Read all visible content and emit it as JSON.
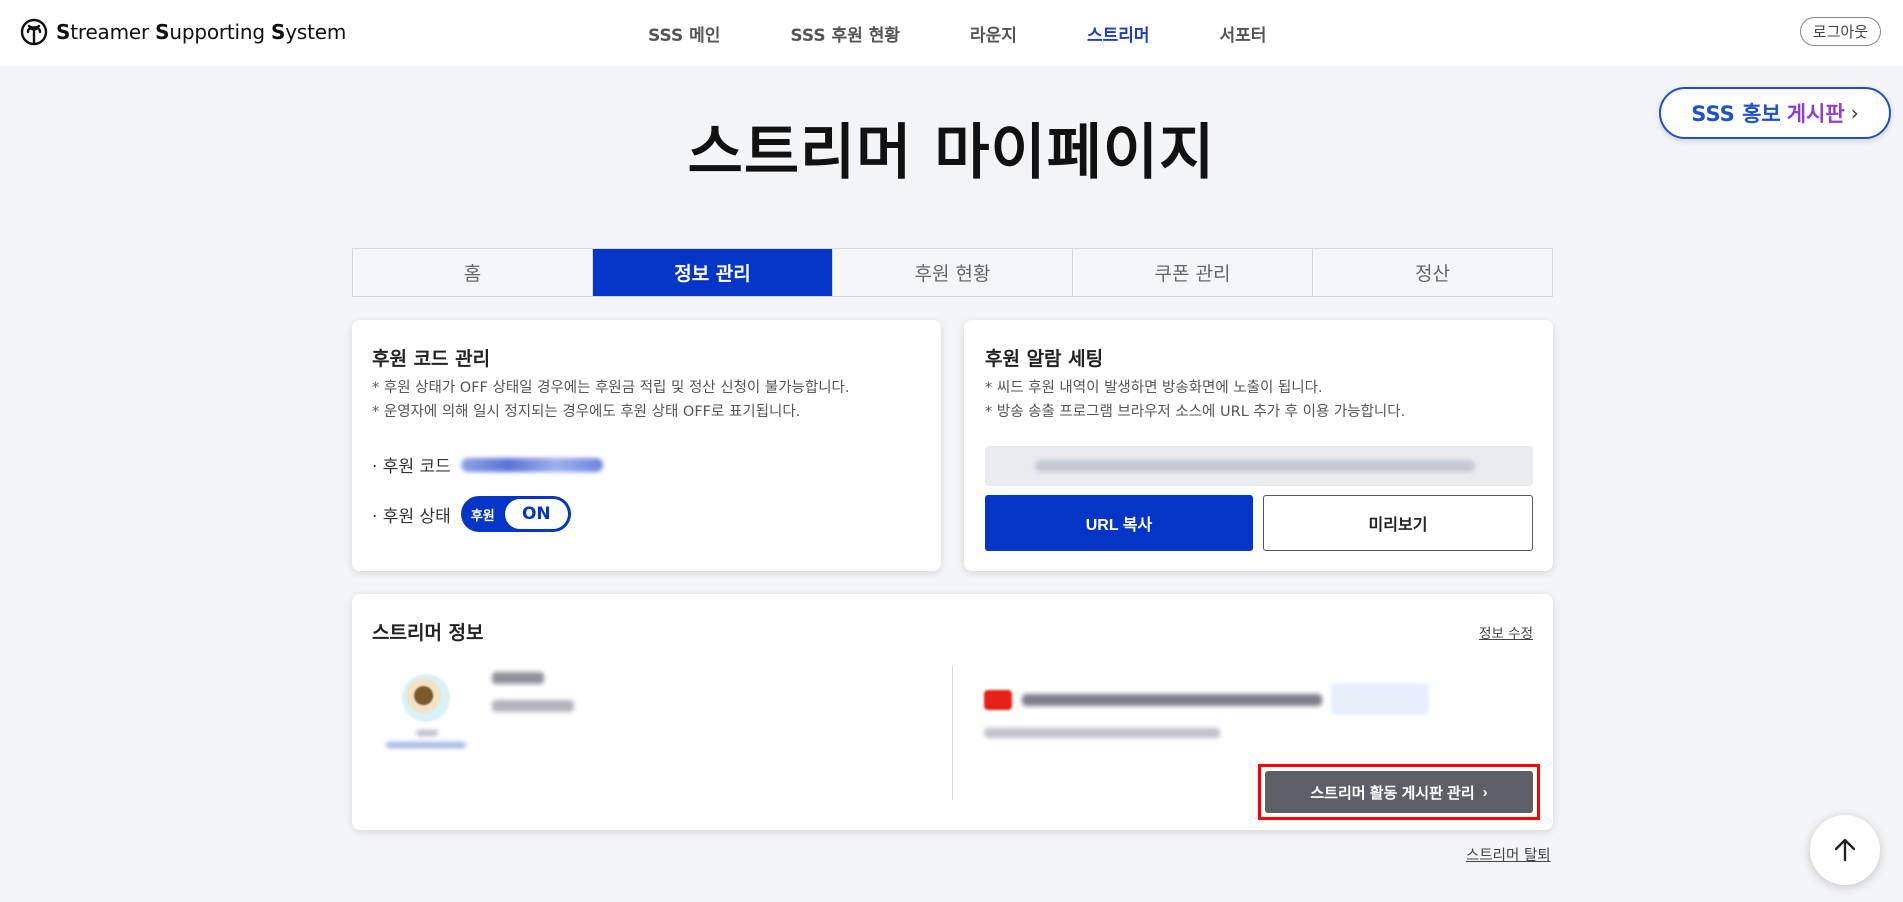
{
  "header": {
    "logo": {
      "s1": "S",
      "t1": "treamer ",
      "s2": "S",
      "t2": "upporting ",
      "s3": "S",
      "t3": "ystem"
    },
    "nav": [
      "SSS 메인",
      "SSS 후원 현황",
      "라운지",
      "스트리머",
      "서포터"
    ],
    "active_nav": "스트리머",
    "logout": "로그아웃"
  },
  "promo": {
    "part1": "SSS 홍보",
    "part2": "게시판",
    "chevron": "›"
  },
  "page_title": "스트리머 마이페이지",
  "tabs": [
    "홈",
    "정보 관리",
    "후원 현황",
    "쿠폰 관리",
    "정산"
  ],
  "active_tab": "정보 관리",
  "code_card": {
    "title": "후원 코드 관리",
    "notes": [
      "* 후원 상태가 OFF 상태일 경우에는 후원금 적립 및 정산 신청이 불가능합니다.",
      "* 운영자에 의해 일시 정지되는 경우에도 후원 상태 OFF로 표기됩니다."
    ],
    "code_label": "· 후원 코드",
    "status_label": "· 후원 상태",
    "toggle_label": "후원",
    "toggle_state": "ON"
  },
  "alarm_card": {
    "title": "후원 알람 세팅",
    "notes": [
      "* 씨드 후원 내역이 발생하면 방송화면에 노출이 됩니다.",
      "* 방송 송출 프로그램 브라우저 소스에 URL 추가 후 이용 가능합니다."
    ],
    "copy_button": "URL 복사",
    "preview_button": "미리보기"
  },
  "info_card": {
    "title": "스트리머 정보",
    "edit_link": "정보 수정",
    "board_button": "스트리머 활동 게시판 관리",
    "board_chevron": "›"
  },
  "withdraw": "스트리머 탈퇴",
  "colors": {
    "primary": "#0535c7",
    "nav_active": "#1a3fbf",
    "promo_blue": "#1e50c8",
    "promo_purple": "#8b3fd9",
    "highlight": "#ff0000"
  }
}
